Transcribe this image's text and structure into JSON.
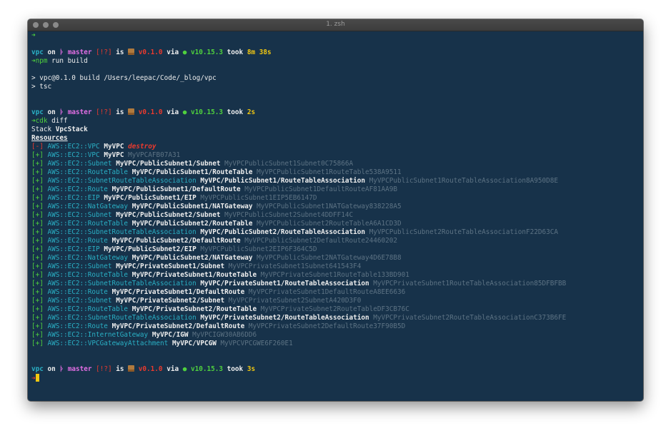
{
  "window": {
    "title": "1. zsh"
  },
  "colors": {
    "background": "#17324a",
    "cyan": "#2ab0c5",
    "green": "#4fd03e",
    "red": "#ea3a2e",
    "magenta": "#e26ee4",
    "yellow": "#f2c811",
    "dim": "#5d7384"
  },
  "prompt": {
    "dir": "vpc",
    "on": "on",
    "branch_icon": "git-branch-icon",
    "branch": "master",
    "status": "[!?]",
    "is": "is",
    "package_icon": "package-icon",
    "version": "v0.1.0",
    "via": "via",
    "node_icon": "node-dot-icon",
    "node_version": "v10.15.3",
    "took": "took"
  },
  "prompts": [
    {
      "duration": "8m 38s"
    },
    {
      "duration": "2s"
    },
    {
      "duration": "3s"
    }
  ],
  "arrow": "➜",
  "commands": [
    {
      "cmd": "npm",
      "args": " run build"
    },
    {
      "cmd": "cdk",
      "args": " diff"
    }
  ],
  "build_output": [
    "> vpc@0.1.0 build /Users/leepac/Code/_blog/vpc",
    "> tsc"
  ],
  "stack": {
    "label": "Stack ",
    "name": "VpcStack"
  },
  "resources_header": "Resources",
  "resources": [
    {
      "mark": "[-]",
      "type": "AWS::EC2::VPC",
      "path": "MyVPC",
      "id": "destroy",
      "destroy": true
    },
    {
      "mark": "[+]",
      "type": "AWS::EC2::VPC",
      "path": "MyVPC",
      "id": "MyVPCAFB07A31"
    },
    {
      "mark": "[+]",
      "type": "AWS::EC2::Subnet",
      "path": "MyVPC/PublicSubnet1/Subnet",
      "id": "MyVPCPublicSubnet1Subnet0C75866A"
    },
    {
      "mark": "[+]",
      "type": "AWS::EC2::RouteTable",
      "path": "MyVPC/PublicSubnet1/RouteTable",
      "id": "MyVPCPublicSubnet1RouteTable538A9511"
    },
    {
      "mark": "[+]",
      "type": "AWS::EC2::SubnetRouteTableAssociation",
      "path": "MyVPC/PublicSubnet1/RouteTableAssociation",
      "id": "MyVPCPublicSubnet1RouteTableAssociation8A950D8E"
    },
    {
      "mark": "[+]",
      "type": "AWS::EC2::Route",
      "path": "MyVPC/PublicSubnet1/DefaultRoute",
      "id": "MyVPCPublicSubnet1DefaultRouteAF81AA9B"
    },
    {
      "mark": "[+]",
      "type": "AWS::EC2::EIP",
      "path": "MyVPC/PublicSubnet1/EIP",
      "id": "MyVPCPublicSubnet1EIP5EB6147D"
    },
    {
      "mark": "[+]",
      "type": "AWS::EC2::NatGateway",
      "path": "MyVPC/PublicSubnet1/NATGateway",
      "id": "MyVPCPublicSubnet1NATGateway838228A5"
    },
    {
      "mark": "[+]",
      "type": "AWS::EC2::Subnet",
      "path": "MyVPC/PublicSubnet2/Subnet",
      "id": "MyVPCPublicSubnet2Subnet4DDFF14C"
    },
    {
      "mark": "[+]",
      "type": "AWS::EC2::RouteTable",
      "path": "MyVPC/PublicSubnet2/RouteTable",
      "id": "MyVPCPublicSubnet2RouteTableA6A1CD3D"
    },
    {
      "mark": "[+]",
      "type": "AWS::EC2::SubnetRouteTableAssociation",
      "path": "MyVPC/PublicSubnet2/RouteTableAssociation",
      "id": "MyVPCPublicSubnet2RouteTableAssociationF22D63CA"
    },
    {
      "mark": "[+]",
      "type": "AWS::EC2::Route",
      "path": "MyVPC/PublicSubnet2/DefaultRoute",
      "id": "MyVPCPublicSubnet2DefaultRoute24460202"
    },
    {
      "mark": "[+]",
      "type": "AWS::EC2::EIP",
      "path": "MyVPC/PublicSubnet2/EIP",
      "id": "MyVPCPublicSubnet2EIP6F364C5D"
    },
    {
      "mark": "[+]",
      "type": "AWS::EC2::NatGateway",
      "path": "MyVPC/PublicSubnet2/NATGateway",
      "id": "MyVPCPublicSubnet2NATGateway4D6E78B8"
    },
    {
      "mark": "[+]",
      "type": "AWS::EC2::Subnet",
      "path": "MyVPC/PrivateSubnet1/Subnet",
      "id": "MyVPCPrivateSubnet1Subnet641543F4"
    },
    {
      "mark": "[+]",
      "type": "AWS::EC2::RouteTable",
      "path": "MyVPC/PrivateSubnet1/RouteTable",
      "id": "MyVPCPrivateSubnet1RouteTable133BD901"
    },
    {
      "mark": "[+]",
      "type": "AWS::EC2::SubnetRouteTableAssociation",
      "path": "MyVPC/PrivateSubnet1/RouteTableAssociation",
      "id": "MyVPCPrivateSubnet1RouteTableAssociation85DFBFBB"
    },
    {
      "mark": "[+]",
      "type": "AWS::EC2::Route",
      "path": "MyVPC/PrivateSubnet1/DefaultRoute",
      "id": "MyVPCPrivateSubnet1DefaultRouteA8EE6636"
    },
    {
      "mark": "[+]",
      "type": "AWS::EC2::Subnet",
      "path": "MyVPC/PrivateSubnet2/Subnet",
      "id": "MyVPCPrivateSubnet2SubnetA420D3F0"
    },
    {
      "mark": "[+]",
      "type": "AWS::EC2::RouteTable",
      "path": "MyVPC/PrivateSubnet2/RouteTable",
      "id": "MyVPCPrivateSubnet2RouteTableDF3CB76C"
    },
    {
      "mark": "[+]",
      "type": "AWS::EC2::SubnetRouteTableAssociation",
      "path": "MyVPC/PrivateSubnet2/RouteTableAssociation",
      "id": "MyVPCPrivateSubnet2RouteTableAssociationC373B6FE"
    },
    {
      "mark": "[+]",
      "type": "AWS::EC2::Route",
      "path": "MyVPC/PrivateSubnet2/DefaultRoute",
      "id": "MyVPCPrivateSubnet2DefaultRoute37F90B5D"
    },
    {
      "mark": "[+]",
      "type": "AWS::EC2::InternetGateway",
      "path": "MyVPC/IGW",
      "id": "MyVPCIGW30AB6DD6"
    },
    {
      "mark": "[+]",
      "type": "AWS::EC2::VPCGatewayAttachment",
      "path": "MyVPC/VPCGW",
      "id": "MyVPCVPCGWE6F260E1"
    }
  ]
}
